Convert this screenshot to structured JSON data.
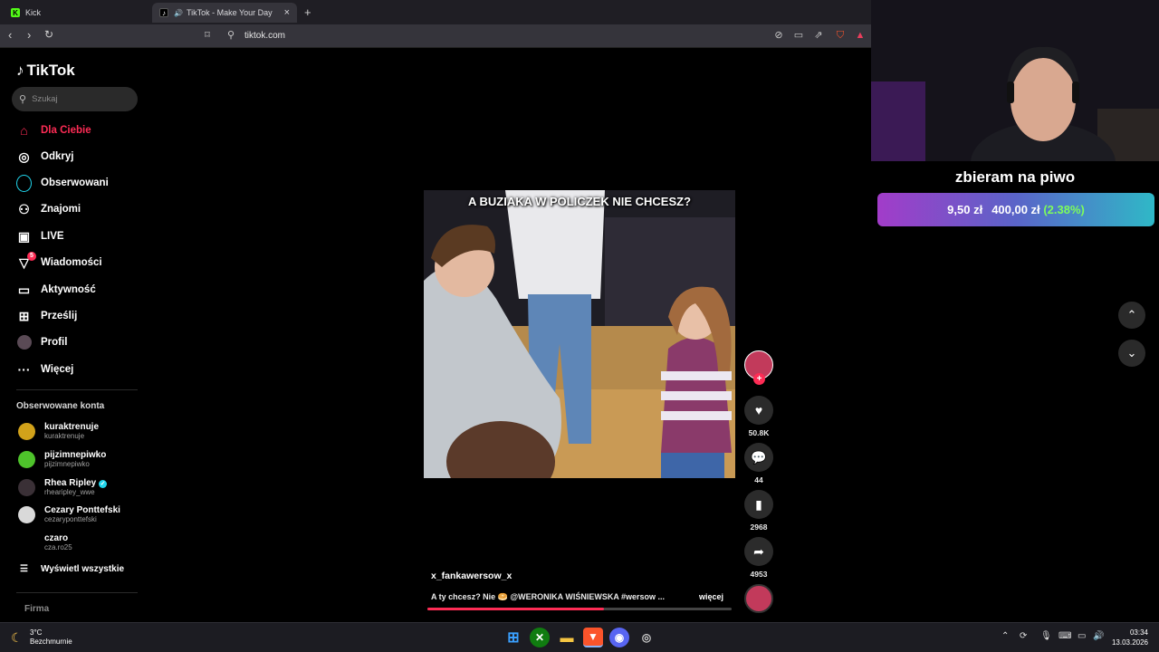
{
  "browser": {
    "tabs": [
      {
        "title": "Kick",
        "favicon": "kick-icon",
        "active": false
      },
      {
        "title": "TikTok - Make Your Day",
        "favicon": "tiktok-icon",
        "active": true
      }
    ],
    "new_tab": "+",
    "tab_close": "×",
    "url": "tiktok.com"
  },
  "sidebar": {
    "logo": "TikTok",
    "search_placeholder": "Szukaj",
    "nav": [
      {
        "label": "Dla Ciebie",
        "icon": "home-icon"
      },
      {
        "label": "Odkryj",
        "icon": "compass-icon"
      },
      {
        "label": "Obserwowani",
        "icon": "following-icon"
      },
      {
        "label": "Znajomi",
        "icon": "friends-icon"
      },
      {
        "label": "LIVE",
        "icon": "live-icon"
      },
      {
        "label": "Wiadomości",
        "icon": "messages-icon",
        "badge": "5"
      },
      {
        "label": "Aktywność",
        "icon": "activity-icon"
      },
      {
        "label": "Prześlij",
        "icon": "upload-icon"
      },
      {
        "label": "Profil",
        "icon": "profile-icon"
      },
      {
        "label": "Więcej",
        "icon": "more-icon"
      }
    ],
    "followed_title": "Obserwowane konta",
    "accounts": [
      {
        "name": "kuraktrenuje",
        "handle": "kuraktrenuje"
      },
      {
        "name": "pijzimnepiwko",
        "handle": "pijzimnepiwko"
      },
      {
        "name": "Rhea Ripley",
        "handle": "rhearipley_wwe",
        "verified": true
      },
      {
        "name": "Cezary Ponttefski",
        "handle": "cezaryponttefski"
      },
      {
        "name": "czaro",
        "handle": "cza.ro25"
      }
    ],
    "show_all": "Wyświetl wszystkie",
    "footer": "Firma"
  },
  "video": {
    "caption": "A BUZIAKA W POLICZEK NIE CHCESZ?",
    "author": "x_fankawersow_x",
    "description": "A ty chcesz? Nie 🥯 @WERONIKA WIŚNIEWSKA #wersow ...",
    "more_label": "więcej",
    "progress": 0.58
  },
  "actions": {
    "likes": "50.8K",
    "comments": "44",
    "saves": "2968",
    "shares": "4953"
  },
  "overlay": {
    "goal_title": "zbieram na piwo",
    "current": "9,50 zł",
    "target": "400,00 zł",
    "percent": "(2.38%)"
  },
  "taskbar": {
    "temp": "3°C",
    "weather": "Bezchmurnie",
    "time": "03:34",
    "date": "13.03.2026"
  },
  "colors": {
    "accent": "#fe2c55",
    "goal_percent": "#7dfc5d"
  }
}
